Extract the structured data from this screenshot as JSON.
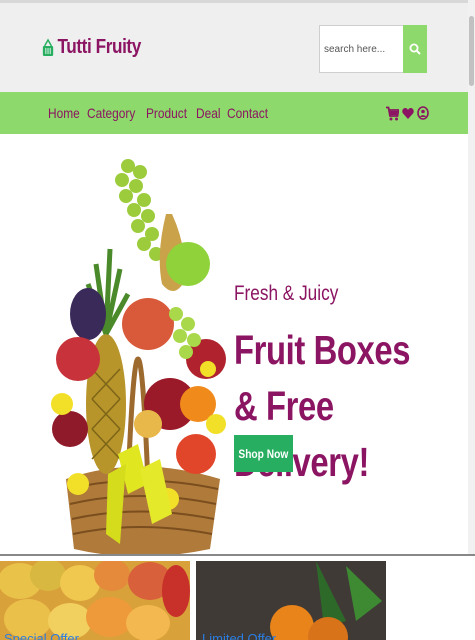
{
  "brand": {
    "name": "Tutti Fruity",
    "icon": "basket-icon"
  },
  "search": {
    "placeholder": "search here...",
    "icon": "search-icon"
  },
  "nav": {
    "items": [
      {
        "label": "Home"
      },
      {
        "label": "Category"
      },
      {
        "label": "Product"
      },
      {
        "label": "Deal"
      },
      {
        "label": "Contact"
      }
    ],
    "icons": [
      "cart-icon",
      "heart-icon",
      "user-icon"
    ]
  },
  "hero": {
    "subtitle": "Fresh & Juicy",
    "title_line1": "Fruit Boxes & Free",
    "title_line2": "Delivery!",
    "cta": "Shop Now"
  },
  "offers": [
    {
      "label": "Special Offer"
    },
    {
      "label": "Limited Offer"
    }
  ],
  "colors": {
    "brand": "#8b1562",
    "nav_bg": "#8ed96b",
    "cta": "#27ae60"
  }
}
